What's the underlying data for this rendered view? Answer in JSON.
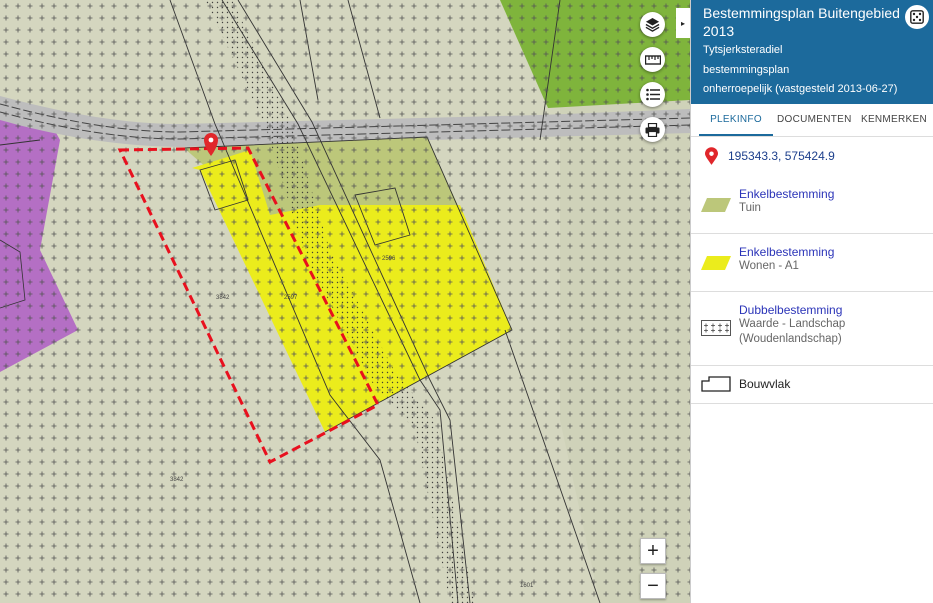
{
  "map": {
    "parcels": [
      "3842",
      "2597",
      "2596",
      "3842",
      "1601"
    ],
    "controls": {
      "layers_icon": "layers-icon",
      "measure_icon": "ruler-icon",
      "legend_icon": "list-icon",
      "print_icon": "printer-icon",
      "zoom_in": "+",
      "zoom_out": "−",
      "collapse": "▸"
    },
    "colors": {
      "background": "#d6d7c2",
      "tuin": "#bcc77a",
      "wonen": "#ebec1c",
      "green_area": "#7fb43c",
      "purple_area": "#b46fc4",
      "selection": "#e8101e",
      "road": "#bdbdbd"
    }
  },
  "panel": {
    "title": "Bestemmingsplan Buitengebied 2013",
    "municipality": "Tytsjerksteradiel",
    "type": "bestemmingsplan",
    "status": "onherroepelijk (vastgesteld 2013-06-27)",
    "tabs": [
      {
        "label": "PLEKINFO",
        "active": true
      },
      {
        "label": "DOCUMENTEN",
        "active": false
      },
      {
        "label": "KENMERKEN",
        "active": false
      }
    ],
    "coordinates": "195343.3, 575424.9",
    "legend": [
      {
        "title": "Enkelbestemming",
        "sub": "Tuin",
        "swatch": "#bcc77a"
      },
      {
        "title": "Enkelbestemming",
        "sub": "Wonen - A1",
        "swatch": "#ebec1c"
      },
      {
        "title": "Dubbelbestemming",
        "sub": "Waarde - Landschap (Woudenlandschap)",
        "swatch": "dotted"
      },
      {
        "title": "Bouwvlak",
        "sub": "",
        "swatch": "outline"
      }
    ]
  }
}
